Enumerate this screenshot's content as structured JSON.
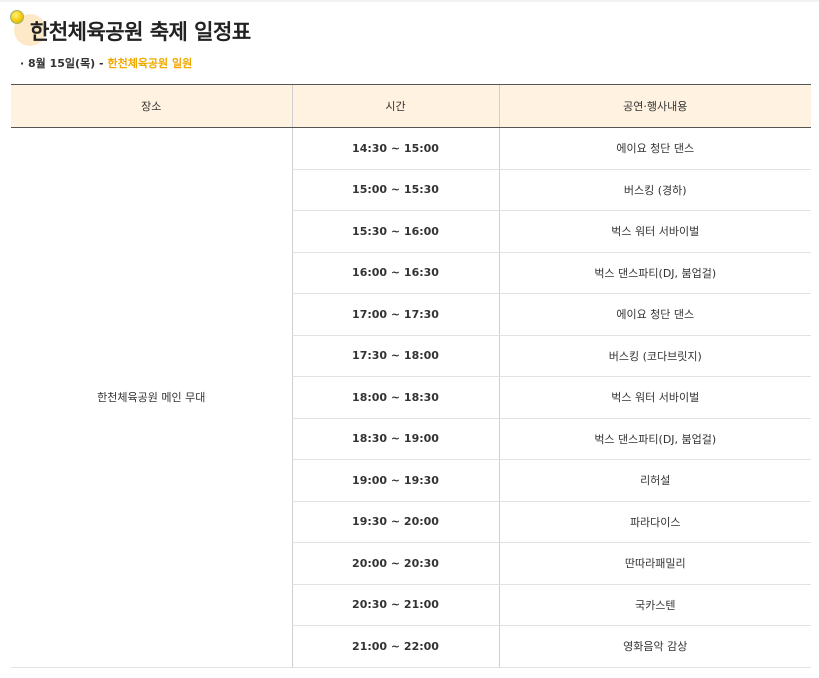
{
  "page": {
    "title": "한천체육공원 축제 일정표",
    "subtitle_date": "· 8월 15일(목) - ",
    "subtitle_venue": "한천체육공원 일원",
    "accent_color": "#f2a900",
    "header_bg": "#fff2e0"
  },
  "table": {
    "headers": [
      "장소",
      "시간",
      "공연·행사내용"
    ],
    "venue": "한천체육공원 메인 무대",
    "rows": [
      {
        "time": "14:30 ~ 15:00",
        "event": "에이요 청단 댄스"
      },
      {
        "time": "15:00 ~ 15:30",
        "event": "버스킹 (경하)"
      },
      {
        "time": "15:30 ~ 16:00",
        "event": "벅스 워터 서바이벌"
      },
      {
        "time": "16:00 ~ 16:30",
        "event": "벅스 댄스파티(DJ, 붐업걸)"
      },
      {
        "time": "17:00 ~ 17:30",
        "event": "에이요 청단 댄스"
      },
      {
        "time": "17:30 ~ 18:00",
        "event": "버스킹 (코다브릿지)"
      },
      {
        "time": "18:00 ~ 18:30",
        "event": "벅스 워터 서바이벌"
      },
      {
        "time": "18:30 ~ 19:00",
        "event": "벅스 댄스파티(DJ, 붐업걸)"
      },
      {
        "time": "19:00 ~ 19:30",
        "event": "리허설"
      },
      {
        "time": "19:30 ~ 20:00",
        "event": "파라다이스"
      },
      {
        "time": "20:00 ~ 20:30",
        "event": "딴따라패밀리"
      },
      {
        "time": "20:30 ~ 21:00",
        "event": "국카스텐"
      },
      {
        "time": "21:00 ~ 22:00",
        "event": "영화음악 감상"
      }
    ]
  }
}
